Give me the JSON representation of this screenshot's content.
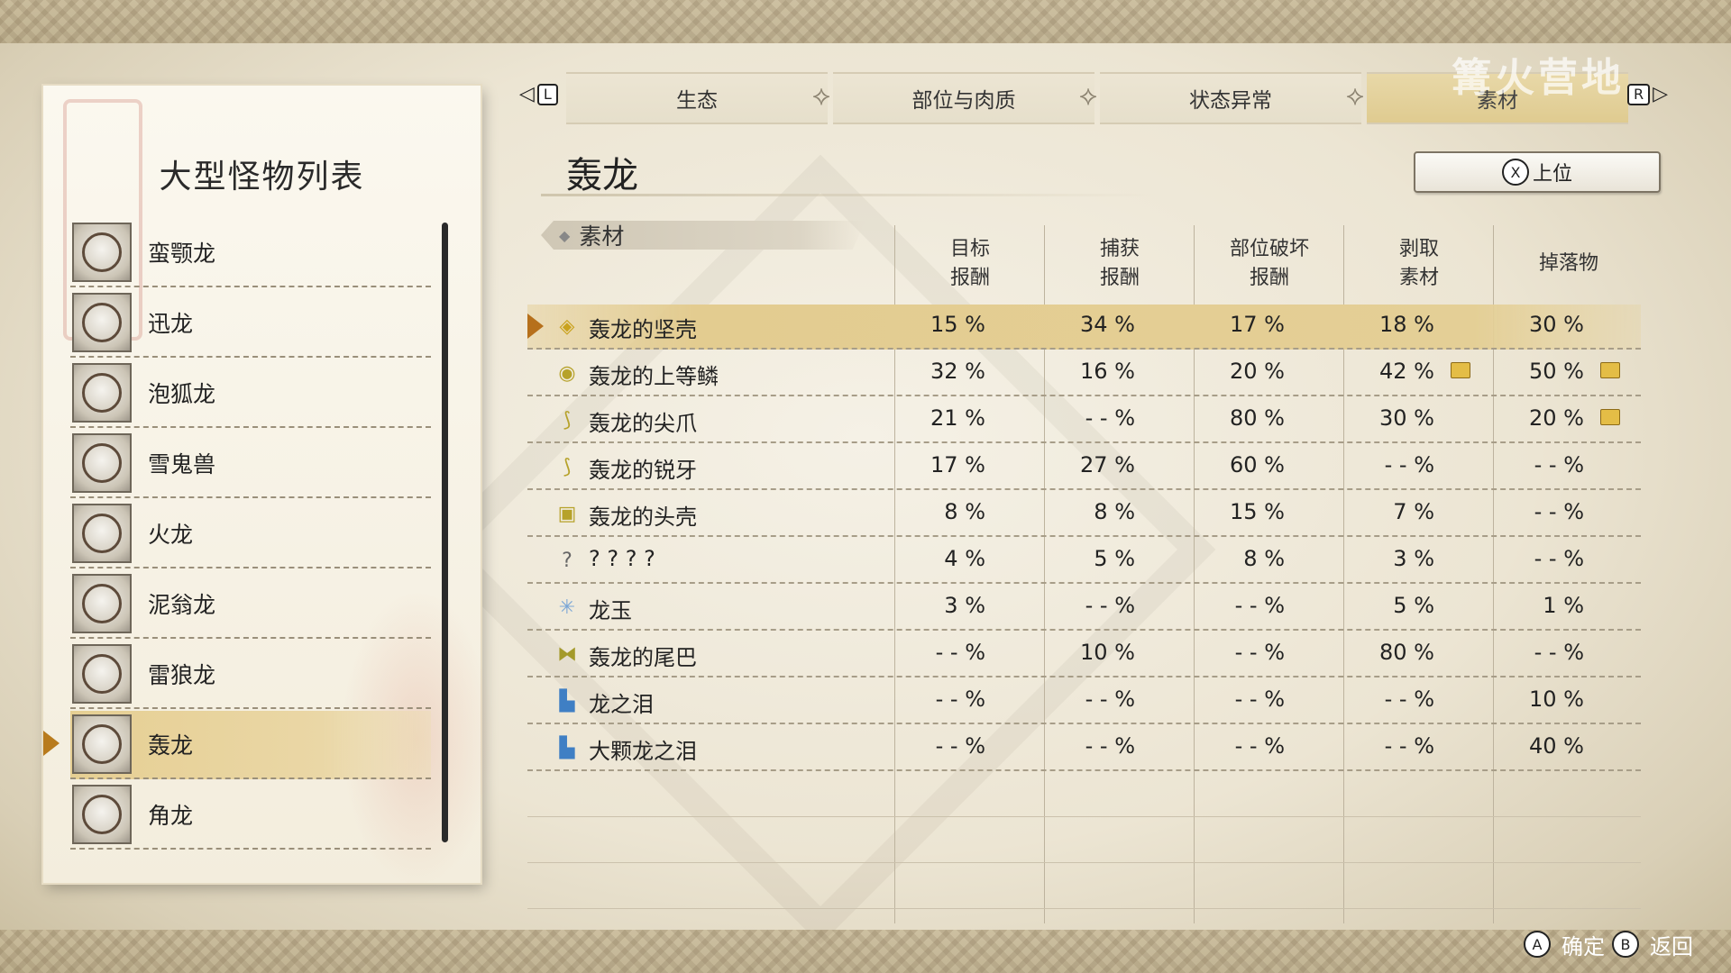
{
  "monster_list": {
    "title": "大型怪物列表",
    "items": [
      {
        "name": "蛮颚龙"
      },
      {
        "name": "迅龙"
      },
      {
        "name": "泡狐龙"
      },
      {
        "name": "雪鬼兽"
      },
      {
        "name": "火龙"
      },
      {
        "name": "泥翁龙"
      },
      {
        "name": "雷狼龙"
      },
      {
        "name": "轰龙"
      },
      {
        "name": "角龙"
      }
    ],
    "selected_index": 7
  },
  "tabs": {
    "left_key": "L",
    "right_key": "R",
    "items": [
      "生态",
      "部位与肉质",
      "状态异常",
      "素材"
    ],
    "active_index": 3
  },
  "watermark": "篝火营地",
  "header": {
    "monster_name": "轰龙",
    "rank_button_key": "X",
    "rank_button_label": "上位"
  },
  "table": {
    "section_label": "素材",
    "columns": [
      "目标\n报酬",
      "捕获\n报酬",
      "部位破坏\n报酬",
      "剥取\n素材",
      "掉落物"
    ],
    "rows": [
      {
        "icon": "shell-icon",
        "name": "轰龙的坚壳",
        "values": [
          "15 %",
          "34 %",
          "17 %",
          "18 %",
          "30 %"
        ],
        "selected": true
      },
      {
        "icon": "scale-icon",
        "name": "轰龙的上等鳞",
        "values": [
          "32 %",
          "16 %",
          "20 %",
          "42 %",
          "50 %"
        ],
        "extra_icons": [
          3,
          4
        ]
      },
      {
        "icon": "claw-icon",
        "name": "轰龙的尖爪",
        "values": [
          "21 %",
          "- - %",
          "80 %",
          "30 %",
          "20 %"
        ],
        "extra_icons": [
          4
        ]
      },
      {
        "icon": "fang-icon",
        "name": "轰龙的锐牙",
        "values": [
          "17 %",
          "27 %",
          "60 %",
          "- - %",
          "- - %"
        ]
      },
      {
        "icon": "head-shell-icon",
        "name": "轰龙的头壳",
        "values": [
          "8 %",
          "8 %",
          "15 %",
          "7 %",
          "- - %"
        ]
      },
      {
        "icon": "unknown-icon",
        "name": "? ? ? ?",
        "values": [
          "4 %",
          "5 %",
          "8 %",
          "3 %",
          "- - %"
        ]
      },
      {
        "icon": "gem-icon",
        "name": "龙玉",
        "values": [
          "3 %",
          "- - %",
          "- - %",
          "5 %",
          "1 %"
        ]
      },
      {
        "icon": "tail-icon",
        "name": "轰龙的尾巴",
        "values": [
          "- - %",
          "10 %",
          "- - %",
          "80 %",
          "- - %"
        ]
      },
      {
        "icon": "tear-icon",
        "name": "龙之泪",
        "values": [
          "- - %",
          "- - %",
          "- - %",
          "- - %",
          "10 %"
        ]
      },
      {
        "icon": "tear-icon",
        "name": "大颗龙之泪",
        "values": [
          "- - %",
          "- - %",
          "- - %",
          "- - %",
          "40 %"
        ]
      }
    ]
  },
  "footer": {
    "confirm_key": "A",
    "confirm_label": "确定",
    "back_key": "B",
    "back_label": "返回"
  }
}
